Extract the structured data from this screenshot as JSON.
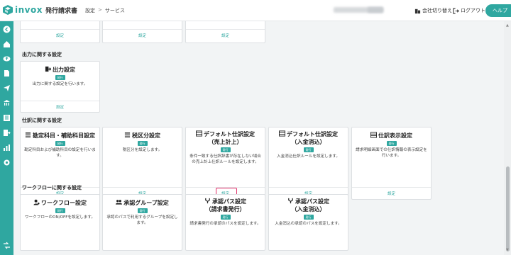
{
  "header": {
    "logo_text": "invox",
    "logo_sub": "発行請求書",
    "breadcrumb": [
      "設定",
      "サービス"
    ],
    "breadcrumb_sep": ">",
    "switch_company": "会社切り替え",
    "logout": "ログアウト",
    "help": "ヘルプ"
  },
  "top_row": {
    "links": [
      "設定",
      "設定",
      "設定"
    ]
  },
  "sections": {
    "output": {
      "title": "出力に関する設定",
      "cards": [
        {
          "title": "出力設定",
          "badge": "発行",
          "desc": "出力に関する設定を行います。",
          "link": "設定",
          "icon": "export-icon"
        }
      ]
    },
    "journal": {
      "title": "仕訳に関する設定",
      "cards": [
        {
          "title": "勘定科目・補助科目設定",
          "badge": "発行",
          "desc": "勘定科目および補助科目の設定を行います。",
          "link": "設定",
          "icon": "list-icon"
        },
        {
          "title": "税区分設定",
          "badge": "発行",
          "desc": "税区分を設定します。",
          "link": "設定",
          "icon": "list-icon"
        },
        {
          "title_line1": "デフォルト仕訳設定",
          "title_line2": "（売上計上）",
          "badge": "発行",
          "desc_line1": "条件一致する仕訳辞書が存在しない場合",
          "desc_line2": "の売上計上仕訳ルールを設定します。",
          "link": "設定",
          "icon": "table-icon"
        },
        {
          "title_line1": "デフォルト仕訳設定",
          "title_line2": "（入金消込）",
          "badge": "発行",
          "desc": "入金消込仕訳ルールを設定します。",
          "link": "設定",
          "icon": "table-icon"
        },
        {
          "title": "仕訳表示設定",
          "badge": "発行",
          "desc_line1": "請求明細画面での仕訳情報の表示設定を",
          "desc_line2": "行います。",
          "link": "設定",
          "icon": "table-icon"
        }
      ]
    },
    "workflow": {
      "title": "ワークフローに関する設定",
      "cards": [
        {
          "title": "ワークフロー設定",
          "badge": "発行",
          "desc": "ワークフローのON/OFFを設定します。",
          "link": "設定",
          "icon": "user-gear-icon"
        },
        {
          "title": "承認グループ設定",
          "badge": "発行",
          "desc_line1": "承認のパスで利用するグループを設定し",
          "desc_line2": "ます。",
          "link": "設定",
          "icon": "users-icon"
        },
        {
          "title_line1": "承認パス設定",
          "title_line2": "（請求書発行）",
          "badge": "発行",
          "desc": "請求書発行の承認のパスを設定します。",
          "link": "設定",
          "icon": "route-icon"
        },
        {
          "title_line1": "承認パス設定",
          "title_line2": "（入金消込）",
          "badge": "発行",
          "desc": "入金消込の承認のパスを設定します。",
          "link": "設定",
          "icon": "route-icon"
        }
      ]
    }
  },
  "colors": {
    "brand": "#2fa7a0",
    "highlight": "#e0306a"
  }
}
